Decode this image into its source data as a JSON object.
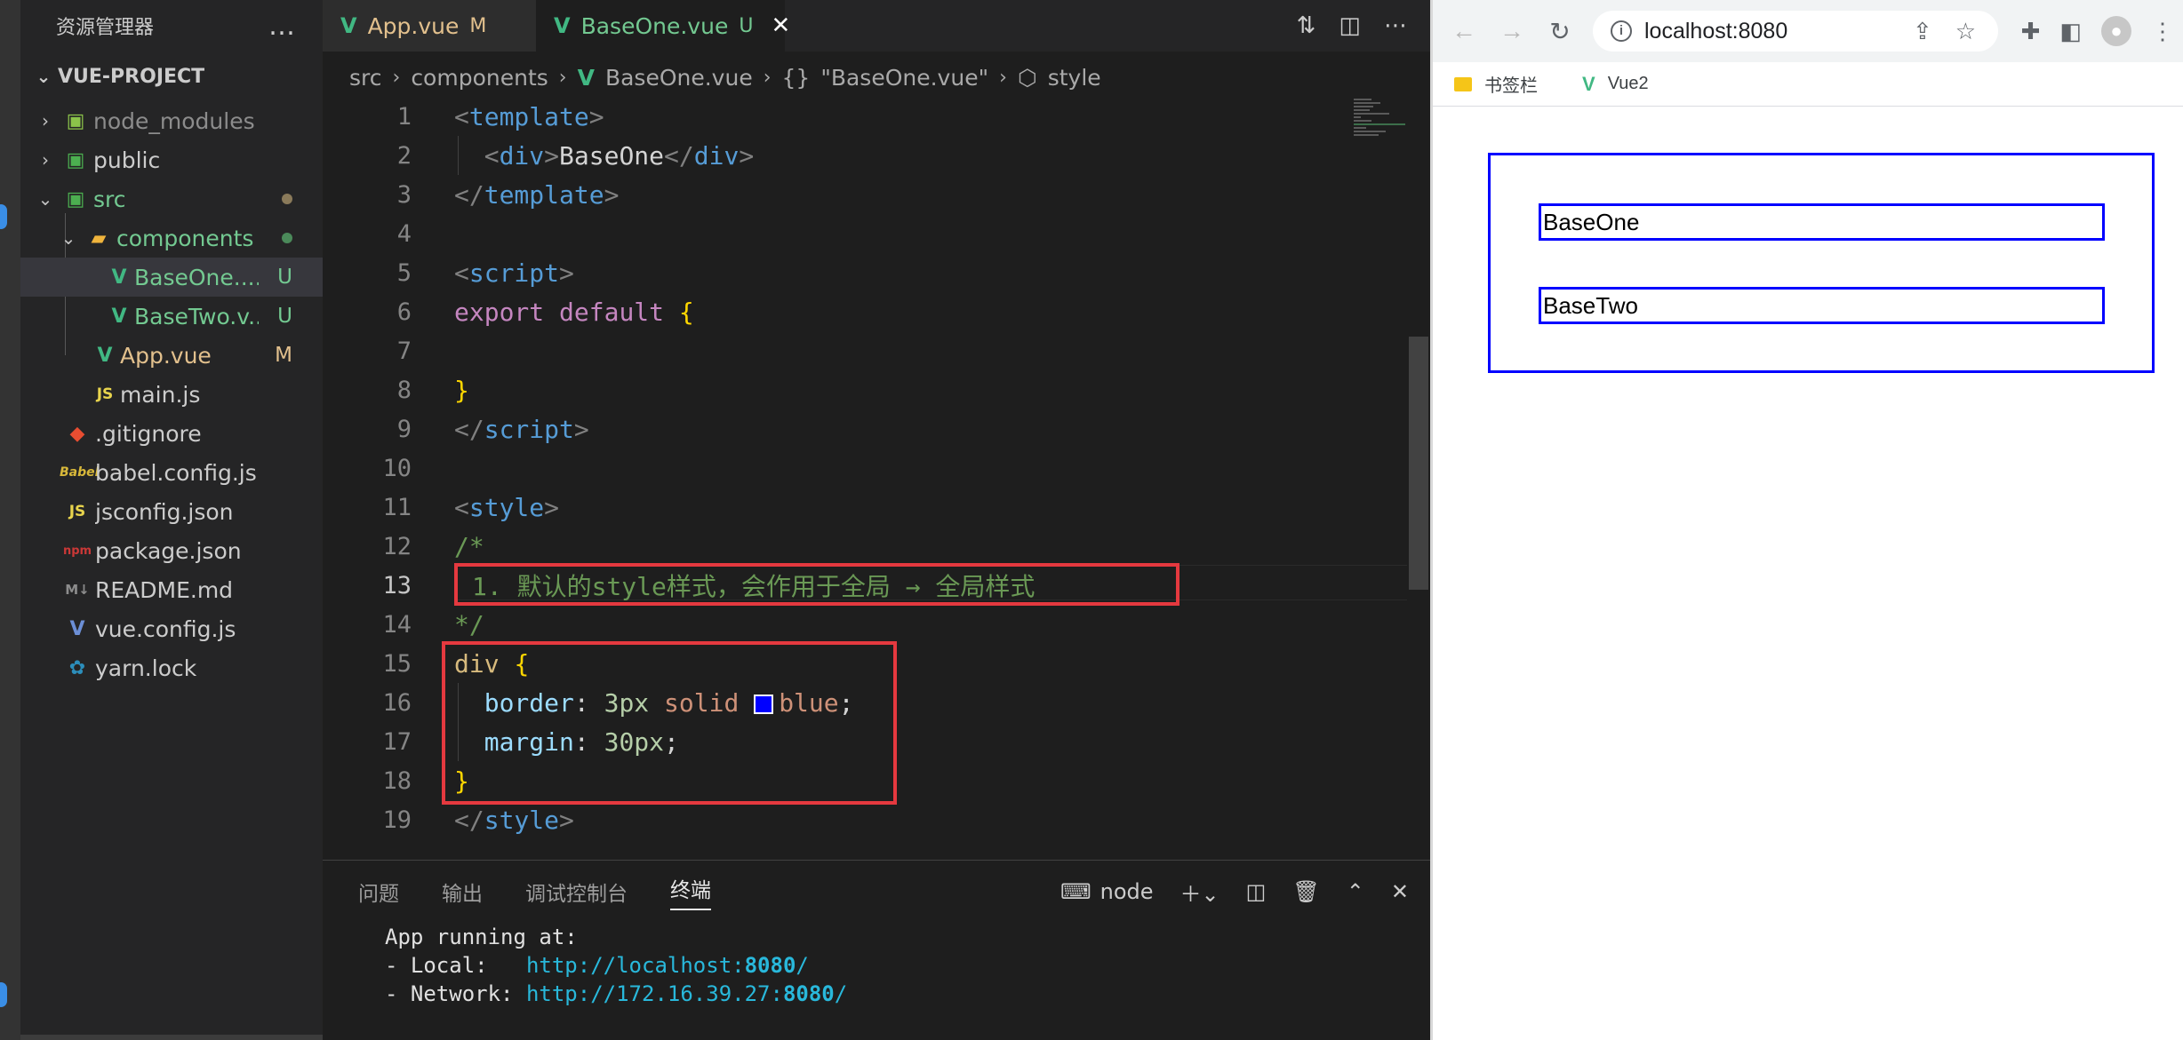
{
  "sidebar": {
    "title": "资源管理器",
    "more_icon": "…",
    "project": "VUE-PROJECT",
    "items": [
      {
        "label": "node_modules",
        "icon": "folder-icon",
        "badge": ""
      },
      {
        "label": "public",
        "icon": "folder-icon",
        "badge": ""
      },
      {
        "label": "src",
        "icon": "folder-icon",
        "badge": ""
      },
      {
        "label": "components",
        "icon": "folder-icon",
        "badge": ""
      },
      {
        "label": "BaseOne....",
        "icon": "vue-file-icon",
        "badge": "U"
      },
      {
        "label": "BaseTwo.v...",
        "icon": "vue-file-icon",
        "badge": "U"
      },
      {
        "label": "App.vue",
        "icon": "vue-file-icon",
        "badge": "M"
      },
      {
        "label": "main.js",
        "icon": "js-file-icon",
        "badge": ""
      },
      {
        "label": ".gitignore",
        "icon": "git-icon",
        "badge": ""
      },
      {
        "label": "babel.config.js",
        "icon": "babel-icon",
        "badge": ""
      },
      {
        "label": "jsconfig.json",
        "icon": "js-file-icon",
        "badge": ""
      },
      {
        "label": "package.json",
        "icon": "npm-icon",
        "badge": ""
      },
      {
        "label": "README.md",
        "icon": "markdown-icon",
        "badge": ""
      },
      {
        "label": "vue.config.js",
        "icon": "vue-file-icon",
        "badge": ""
      },
      {
        "label": "yarn.lock",
        "icon": "yarn-icon",
        "badge": ""
      }
    ]
  },
  "tabs": [
    {
      "label": "App.vue",
      "status": "M",
      "active": false
    },
    {
      "label": "BaseOne.vue",
      "status": "U",
      "active": true,
      "close": "✕"
    }
  ],
  "breadcrumb": {
    "src": "src",
    "components": "components",
    "file": "BaseOne.vue",
    "braces": "{}",
    "object": "\"BaseOne.vue\"",
    "style": "style"
  },
  "code": {
    "line_numbers": [
      "1",
      "2",
      "3",
      "4",
      "5",
      "6",
      "7",
      "8",
      "9",
      "10",
      "11",
      "12",
      "13",
      "14",
      "15",
      "16",
      "17",
      "18",
      "19"
    ],
    "template_tag": "template",
    "div_tag": "div",
    "div_text": "BaseOne",
    "script_tag": "script",
    "export_kw": "export",
    "default_kw": "default",
    "style_tag": "style",
    "comment_open": "/*",
    "comment_text": "1. 默认的style样式，会作用于全局 → 全局样式",
    "comment_close": "*/",
    "selector": "div",
    "prop_border": "border",
    "val_border_num": "3px",
    "val_border_style": "solid",
    "val_border_color": "blue",
    "prop_margin": "margin",
    "val_margin": "30px",
    "swatch_color": "#0000ff"
  },
  "panel": {
    "tabs": [
      "问题",
      "输出",
      "调试控制台",
      "终端"
    ],
    "active_tab": "终端",
    "terminal_name": "node",
    "terminal": {
      "line1": "App running at:",
      "local_label": "- Local:   ",
      "local_url": "http://localhost:",
      "local_port": "8080",
      "local_tail": "/",
      "network_label": "- Network: ",
      "network_url": "http://172.16.39.27:",
      "network_port": "8080",
      "network_tail": "/"
    }
  },
  "browser": {
    "url": "localhost:8080",
    "bookmarks": [
      "书签栏",
      "Vue2"
    ],
    "page": {
      "base_one": "BaseOne",
      "base_two": "BaseTwo"
    },
    "border_color": "#0000ff"
  },
  "colors": {
    "highlight_box": "#e5393f",
    "vue_green": "#41b883",
    "modified": "#e2c08d",
    "untracked": "#73c991"
  }
}
